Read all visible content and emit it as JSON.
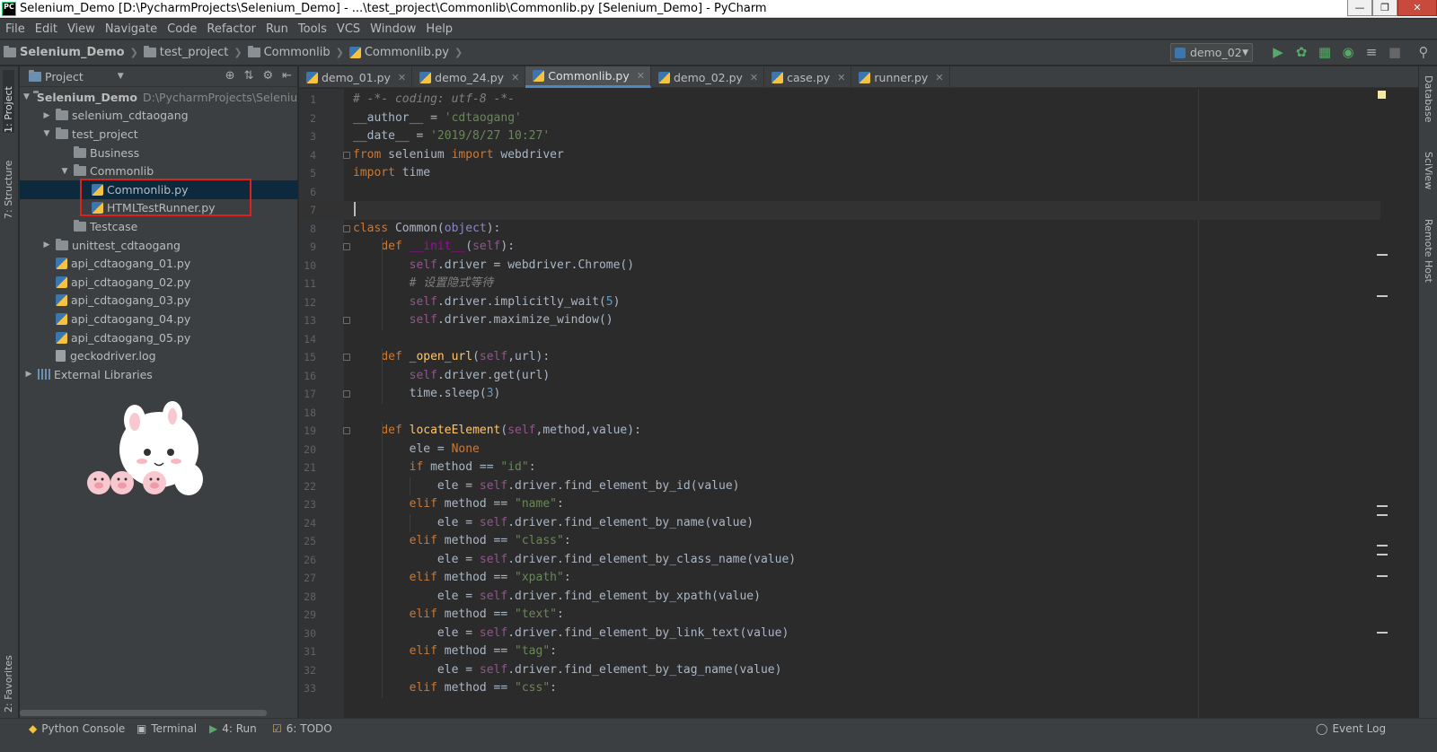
{
  "window": {
    "title": "Selenium_Demo [D:\\PycharmProjects\\Selenium_Demo] - ...\\test_project\\Commonlib\\Commonlib.py [Selenium_Demo] - PyCharm",
    "app_badge": "PC"
  },
  "menu": [
    "File",
    "Edit",
    "View",
    "Navigate",
    "Code",
    "Refactor",
    "Run",
    "Tools",
    "VCS",
    "Window",
    "Help"
  ],
  "breadcrumbs": [
    "Selenium_Demo",
    "test_project",
    "Commonlib",
    "Commonlib.py"
  ],
  "run_config": "demo_02",
  "left_tabs": {
    "project": "1: Project",
    "structure": "7: Structure",
    "favorites": "2: Favorites"
  },
  "right_tabs": {
    "database": "Database",
    "sciview": "SciView",
    "remote": "Remote Host"
  },
  "project_panel": {
    "title": "Project",
    "tree": [
      {
        "label": "Selenium_Demo",
        "path": "D:\\PycharmProjects\\Selenium_",
        "depth": 0,
        "arrow": "▼",
        "type": "folder"
      },
      {
        "label": "selenium_cdtaogang",
        "depth": 1,
        "arrow": "▶",
        "type": "folder"
      },
      {
        "label": "test_project",
        "depth": 1,
        "arrow": "▼",
        "type": "folder"
      },
      {
        "label": "Business",
        "depth": 2,
        "arrow": "",
        "type": "folder"
      },
      {
        "label": "Commonlib",
        "depth": 2,
        "arrow": "▼",
        "type": "folder"
      },
      {
        "label": "Commonlib.py",
        "depth": 3,
        "arrow": "",
        "type": "py",
        "selected": true
      },
      {
        "label": "HTMLTestRunner.py",
        "depth": 3,
        "arrow": "",
        "type": "py"
      },
      {
        "label": "Testcase",
        "depth": 2,
        "arrow": "",
        "type": "folder"
      },
      {
        "label": "unittest_cdtaogang",
        "depth": 1,
        "arrow": "▶",
        "type": "folder"
      },
      {
        "label": "api_cdtaogang_01.py",
        "depth": 1,
        "arrow": "",
        "type": "py"
      },
      {
        "label": "api_cdtaogang_02.py",
        "depth": 1,
        "arrow": "",
        "type": "py"
      },
      {
        "label": "api_cdtaogang_03.py",
        "depth": 1,
        "arrow": "",
        "type": "py"
      },
      {
        "label": "api_cdtaogang_04.py",
        "depth": 1,
        "arrow": "",
        "type": "py"
      },
      {
        "label": "api_cdtaogang_05.py",
        "depth": 1,
        "arrow": "",
        "type": "py"
      },
      {
        "label": "geckodriver.log",
        "depth": 1,
        "arrow": "",
        "type": "log"
      },
      {
        "label": "External Libraries",
        "depth": 0,
        "arrow": "▶",
        "type": "lib"
      }
    ]
  },
  "editor_tabs": [
    {
      "label": "demo_01.py",
      "active": false
    },
    {
      "label": "demo_24.py",
      "active": false
    },
    {
      "label": "Commonlib.py",
      "active": true
    },
    {
      "label": "demo_02.py",
      "active": false
    },
    {
      "label": "case.py",
      "active": false
    },
    {
      "label": "runner.py",
      "active": false
    }
  ],
  "code_lines": [
    "<span class=\"c\"># -*- coding: utf-8 -*-</span>",
    "__author__ = <span class=\"s\">'cdtaogang'</span>",
    "__date__ = <span class=\"s\">'2019/8/27 10:27'</span>",
    "<span class=\"k\">from</span> selenium <span class=\"k\">import</span> webdriver",
    "<span class=\"k\">import</span> time",
    "",
    "",
    "<span class=\"k\">class</span> Common(<span class=\"bi\">object</span>):",
    "    <span class=\"k\">def</span> <span class=\"dn\">__init__</span>(<span class=\"sf\">self</span>):",
    "        <span class=\"sf\">self</span>.driver = webdriver.Chrome()",
    "        <span class=\"c\"># 设置隐式等待</span>",
    "        <span class=\"sf\">self</span>.driver.implicitly_wait(<span class=\"num\">5</span>)",
    "        <span class=\"sf\">self</span>.driver.maximize_window()",
    "",
    "    <span class=\"k\">def</span> <span class=\"fn\">_open_url</span>(<span class=\"sf\">self</span>,url):",
    "        <span class=\"sf\">self</span>.driver.get(url)",
    "        time.sleep(<span class=\"num\">3</span>)",
    "",
    "    <span class=\"k\">def</span> <span class=\"fn\">locateElement</span>(<span class=\"sf\">self</span>,method,value):",
    "        ele = <span class=\"k\">None</span>",
    "        <span class=\"k\">if</span> method == <span class=\"s\">\"id\"</span>:",
    "            ele = <span class=\"sf\">self</span>.driver.find_element_by_id(value)",
    "        <span class=\"k\">elif</span> method == <span class=\"s\">\"name\"</span>:",
    "            ele = <span class=\"sf\">self</span>.driver.find_element_by_name(value)",
    "        <span class=\"k\">elif</span> method == <span class=\"s\">\"class\"</span>:",
    "            ele = <span class=\"sf\">self</span>.driver.find_element_by_class_name(value)",
    "        <span class=\"k\">elif</span> method == <span class=\"s\">\"xpath\"</span>:",
    "            ele = <span class=\"sf\">self</span>.driver.find_element_by_xpath(value)",
    "        <span class=\"k\">elif</span> method == <span class=\"s\">\"text\"</span>:",
    "            ele = <span class=\"sf\">self</span>.driver.find_element_by_link_text(value)",
    "        <span class=\"k\">elif</span> method == <span class=\"s\">\"tag\"</span>:",
    "            ele = <span class=\"sf\">self</span>.driver.find_element_by_tag_name(value)",
    "        <span class=\"k\">elif</span> method == <span class=\"s\">\"css\"</span>:"
  ],
  "status_bar": {
    "python_console": "Python Console",
    "terminal": "Terminal",
    "run": "4: Run",
    "todo": "6: TODO",
    "event_log": "Event Log"
  },
  "colors": {
    "accent": "#4a88c7",
    "bg": "#2b2b2b",
    "panel": "#3c3f41",
    "selection": "#0d293e",
    "highlight_box": "#e0201a"
  }
}
